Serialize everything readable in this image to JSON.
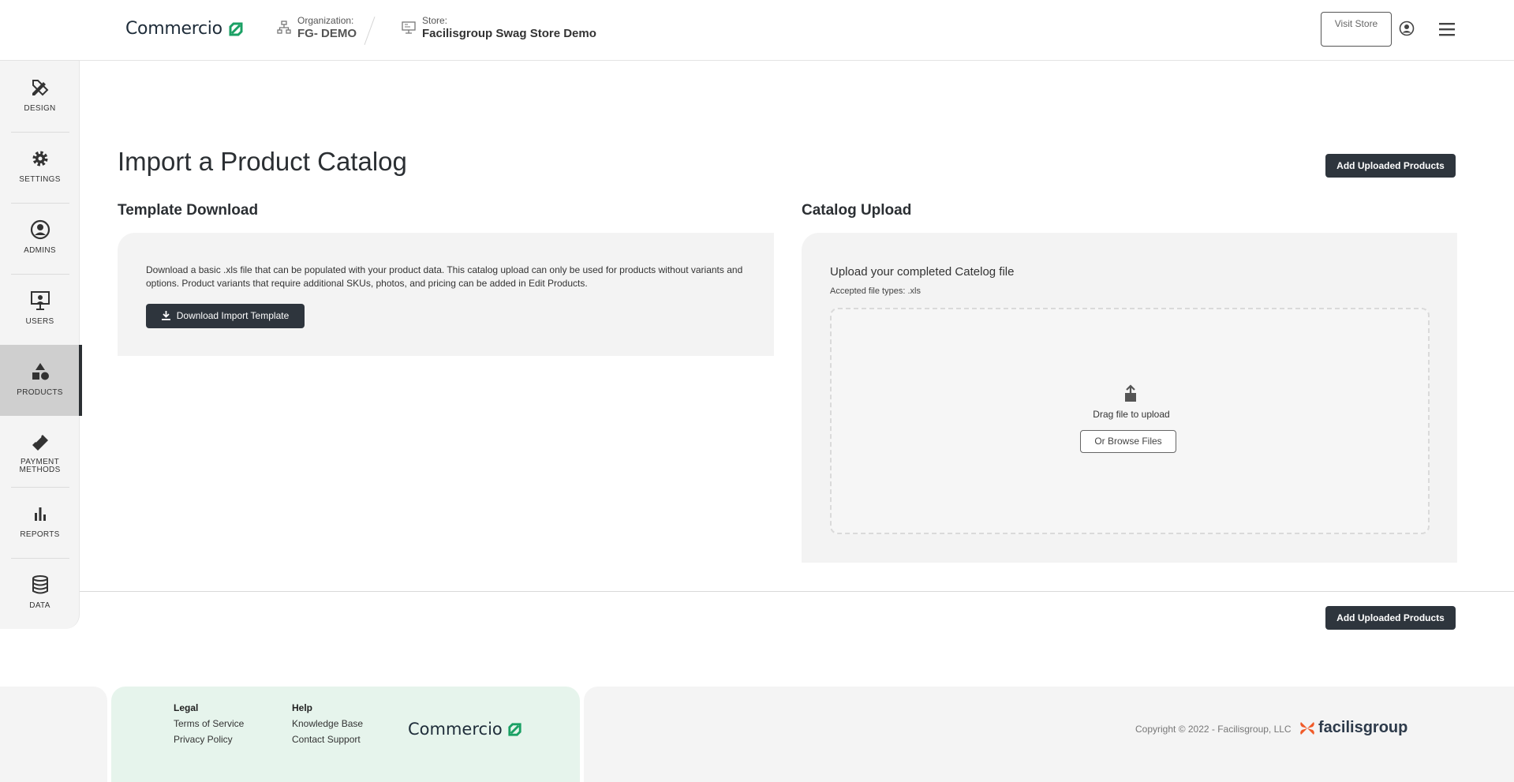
{
  "header": {
    "brand": "Commercio",
    "org_label": "Organization:",
    "org_value": "FG- DEMO",
    "store_label": "Store:",
    "store_value": "Facilisgroup Swag Store Demo",
    "visit_store": "Visit Store"
  },
  "sidebar": {
    "items": [
      {
        "label": "DESIGN",
        "icon": "pencil-ruler-icon"
      },
      {
        "label": "SETTINGS",
        "icon": "gear-icon"
      },
      {
        "label": "ADMINS",
        "icon": "user-circle-icon"
      },
      {
        "label": "USERS",
        "icon": "presentation-user-icon"
      },
      {
        "label": "PRODUCTS",
        "icon": "shapes-icon",
        "active": true
      },
      {
        "label": "PAYMENT METHODS",
        "icon": "card-icon"
      },
      {
        "label": "REPORTS",
        "icon": "bar-chart-icon"
      },
      {
        "label": "DATA",
        "icon": "database-icon"
      }
    ]
  },
  "main": {
    "title": "Import a Product Catalog",
    "add_uploaded": "Add Uploaded Products",
    "template": {
      "heading": "Template Download",
      "description": "Download a basic .xls file that can be populated with your product data. This catalog upload can only be used for products without variants and options. Product variants that require additional SKUs, photos, and pricing can be added in Edit Products.",
      "button": "Download Import Template"
    },
    "upload": {
      "heading": "Catalog Upload",
      "title": "Upload your completed Catelog file",
      "accepted": "Accepted file types: .xls",
      "drag_text": "Drag file to upload",
      "browse": "Or Browse Files"
    }
  },
  "footer": {
    "legal_heading": "Legal",
    "terms": "Terms of Service",
    "privacy": "Privacy Policy",
    "help_heading": "Help",
    "kb": "Knowledge Base",
    "support": "Contact Support",
    "brand": "Commercio",
    "copyright": "Copyright © 2022 - Facilisgroup, LLC",
    "company_logo": "facilisgroup"
  },
  "colors": {
    "accent_green": "#1aa064",
    "dark_button": "#2e353d",
    "footer_green": "#e6f4ec",
    "facilis_orange": "#f05a28"
  }
}
